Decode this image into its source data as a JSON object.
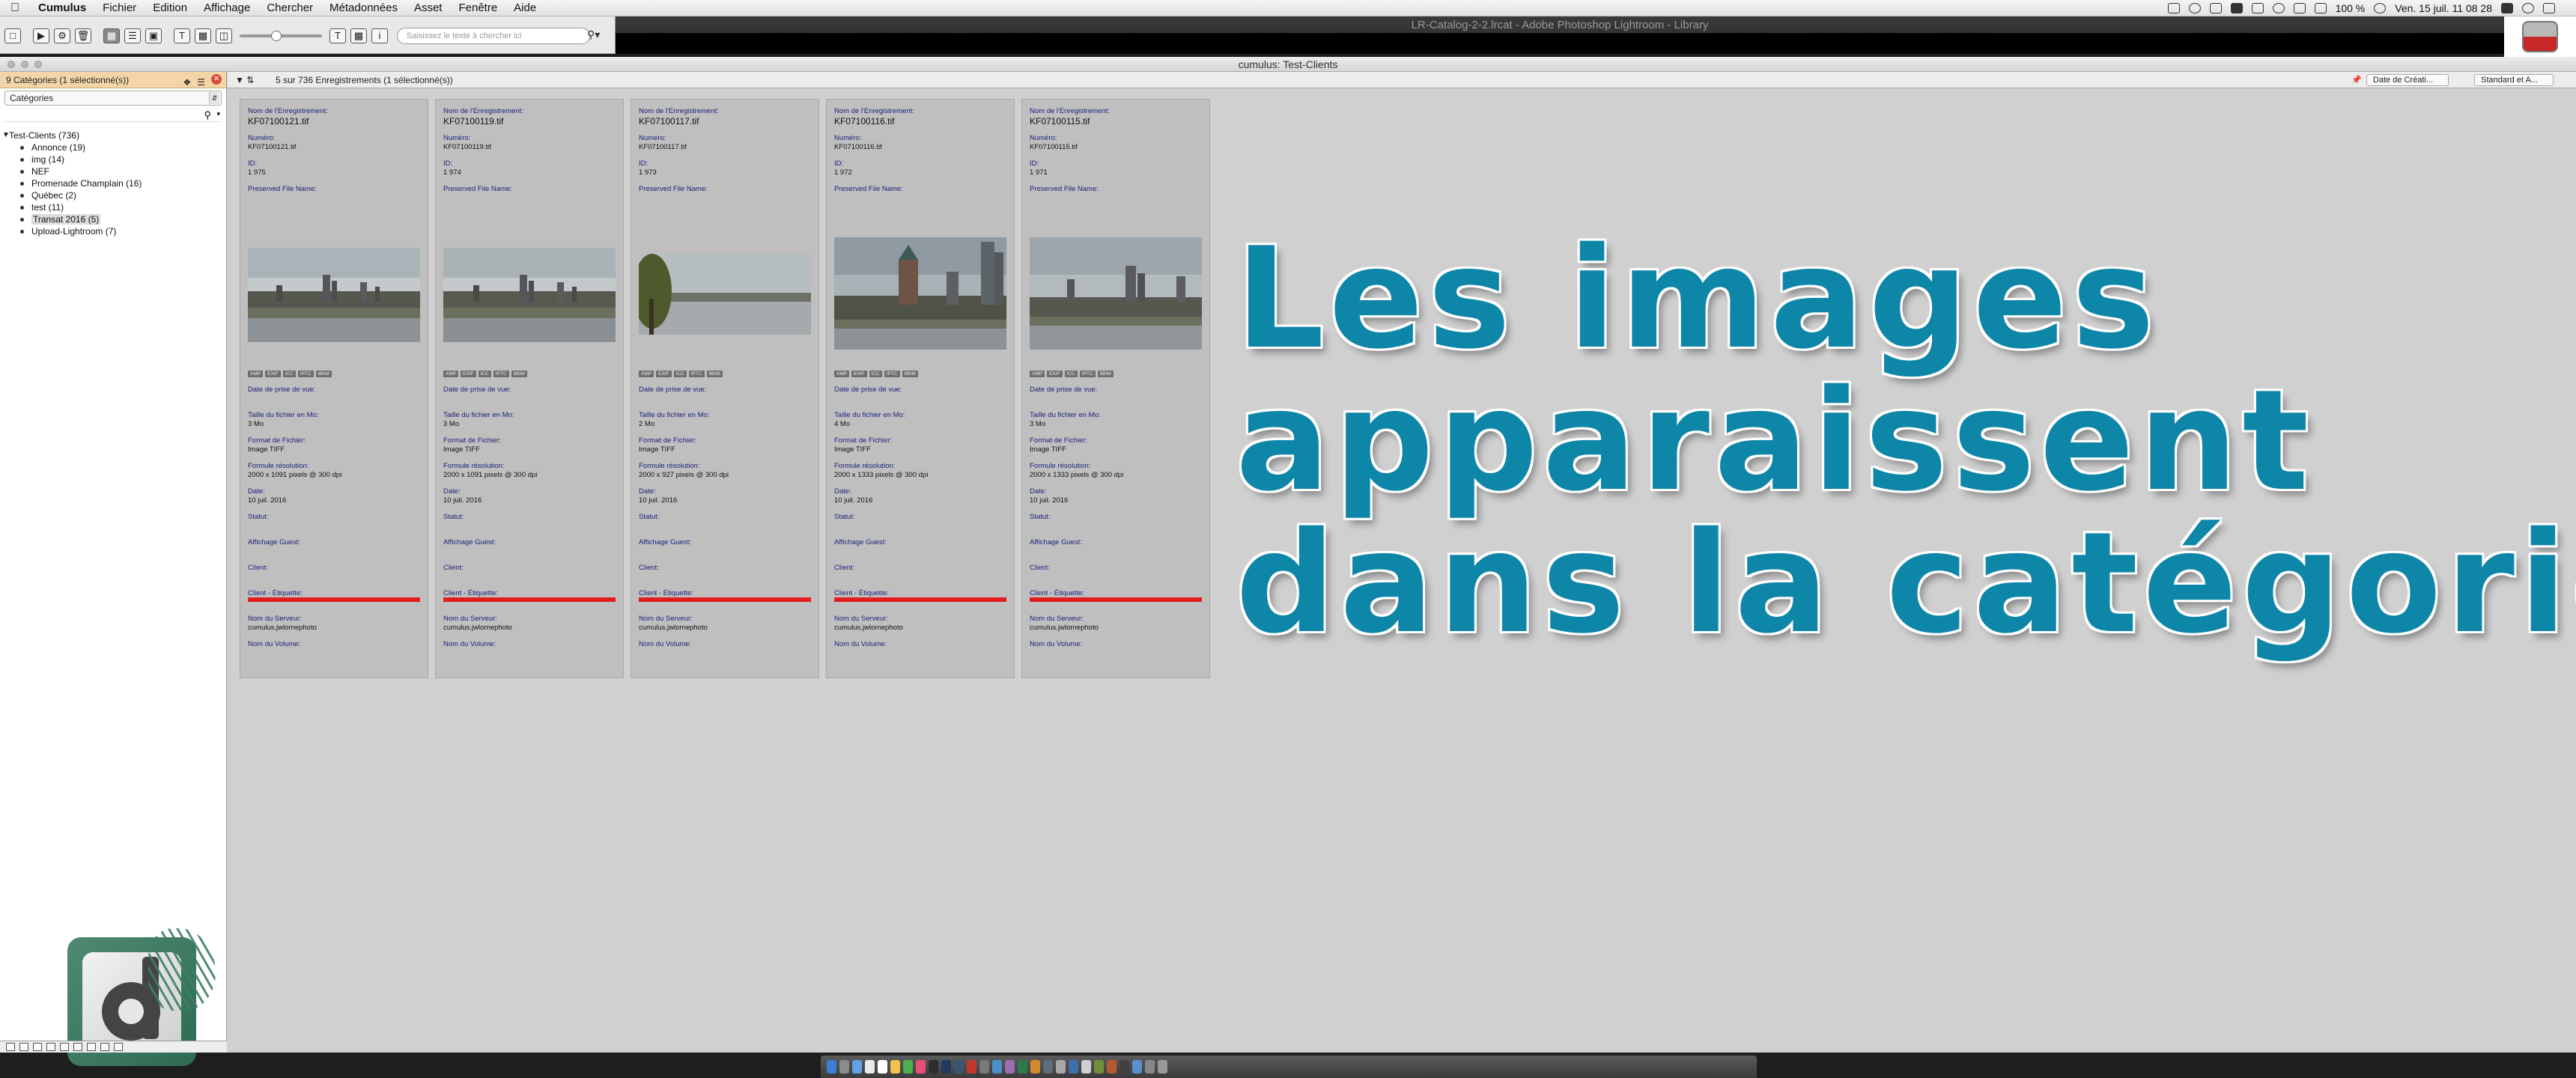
{
  "menubar": {
    "app": "Cumulus",
    "items": [
      "Fichier",
      "Edition",
      "Affichage",
      "Chercher",
      "Métadonnées",
      "Asset",
      "Fenêtre",
      "Aide"
    ],
    "zoom": "100 %",
    "clock": "Ven. 15 juil. 11 08 28"
  },
  "toolbar": {
    "search_placeholder": "Saisissez le texte à chercher ici"
  },
  "background_window": {
    "title": "LR-Catalog-2-2.lrcat - Adobe Photoshop Lightroom - Library"
  },
  "window": {
    "title": "cumulus: Test-Clients"
  },
  "left_panel": {
    "header": "9 Catégories (1 sélectionné(s))",
    "category_select": "Catégories",
    "root": "Test-Clients (736)",
    "items": [
      "Annonce (19)",
      "img (14)",
      "NEF",
      "Promenade Champlain (16)",
      "Québec (2)",
      "test (11)",
      "Transat 2016 (5)",
      "Upload-Lightroom (7)"
    ],
    "selected_index": 6
  },
  "results_bar": {
    "count": "5 sur 736 Enregistrements (1 sélectionné(s))",
    "sort": "Date de Créati...",
    "view": "Standard et A..."
  },
  "labels": {
    "name": "Nom de l'Enregistrement:",
    "number": "Numéro:",
    "id": "ID:",
    "preserved": "Preserved File Name:",
    "shoot_date": "Date de prise de vue:",
    "size": "Taille du fichier en Mo:",
    "format": "Format de Fichier:",
    "resolution": "Formule résolution:",
    "date": "Date:",
    "status": "Statut:",
    "guest": "Affichage Guest:",
    "client": "Client:",
    "client_label": "Client - Étiquette:",
    "server": "Nom du Serveur:",
    "volume": "Nom du Volume:"
  },
  "badge_labels": [
    "XMP",
    "EXIF",
    "ICC",
    "IPTC",
    "8BIM"
  ],
  "records": [
    {
      "name": "KF07100121.tif",
      "number": "KF07100121.tif",
      "id": "1 975",
      "size": "3 Mo",
      "format": "Image TIFF",
      "resolution": "2000 x 1091 pixels @ 300 dpi",
      "date": "10 juil. 2016",
      "server": "cumulus.jwlornephoto"
    },
    {
      "name": "KF07100119.tif",
      "number": "KF07100119.tif",
      "id": "1 974",
      "size": "3 Mo",
      "format": "Image TIFF",
      "resolution": "2000 x 1091 pixels @ 300 dpi",
      "date": "10 juil. 2016",
      "server": "cumulus.jwlornephoto"
    },
    {
      "name": "KF07100117.tif",
      "number": "KF07100117.tif",
      "id": "1 973",
      "size": "2 Mo",
      "format": "Image TIFF",
      "resolution": "2000 x 927 pixels @ 300 dpi",
      "date": "10 juil. 2016",
      "server": "cumulus.jwlornephoto"
    },
    {
      "name": "KF07100116.tif",
      "number": "KF07100116.tif",
      "id": "1 972",
      "size": "4 Mo",
      "format": "Image TIFF",
      "resolution": "2000 x 1333 pixels @ 300 dpi",
      "date": "10 juil. 2016",
      "server": "cumulus.jwlornephoto"
    },
    {
      "name": "KF07100115.tif",
      "number": "KF07100115.tif",
      "id": "1 971",
      "size": "3 Mo",
      "format": "Image TIFF",
      "resolution": "2000 x 1333 pixels @ 300 dpi",
      "date": "10 juil. 2016",
      "server": "cumulus.jwlornephoto"
    }
  ],
  "overlay": {
    "line1": "Les images",
    "line2": "apparaissent",
    "line3": "dans la catégorie"
  },
  "colors": {
    "headline": "#0e86a8",
    "selection_header": "#f3d5a8",
    "guest_bar": "#e31d1d"
  }
}
